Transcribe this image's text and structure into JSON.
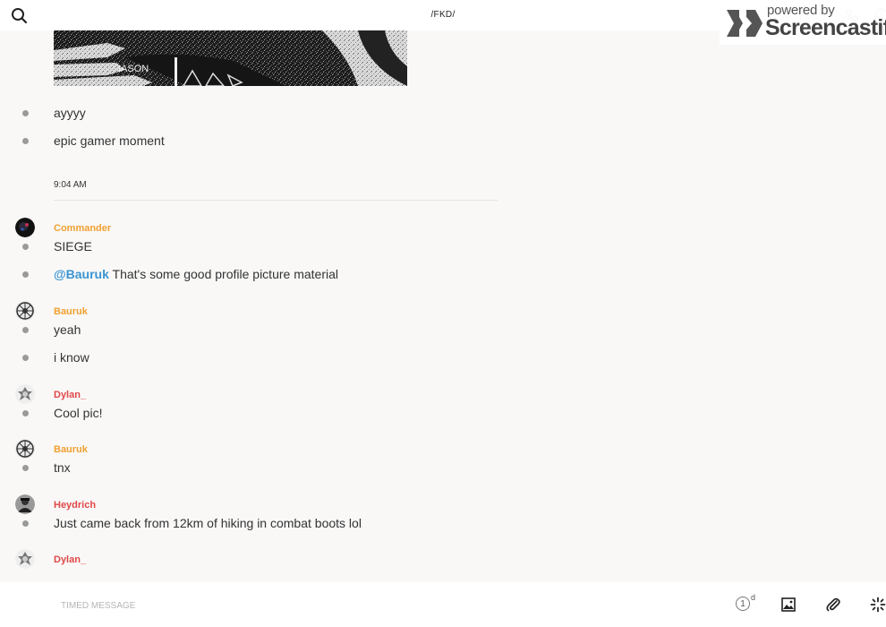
{
  "header": {
    "title": "/FKD/",
    "search_icon": "search-icon",
    "call_icon": "phone-icon",
    "info_icon": "info-icon"
  },
  "watermark": {
    "powered": "powered by",
    "brand": "Screencastify"
  },
  "image_preview": {
    "caption_fragment": "IASON"
  },
  "messages_top": [
    {
      "text": "ayyyy"
    },
    {
      "text": "epic gamer moment"
    }
  ],
  "time_separator": "9:04 AM",
  "groups": [
    {
      "author": "Commander",
      "author_color": "#f0a030",
      "messages": [
        "SIEGE"
      ],
      "mention": "@Bauruk",
      "mention_rest": " That's some good profile picture material"
    },
    {
      "author": "Bauruk",
      "author_color": "#f0a030",
      "messages": [
        "yeah",
        "i know"
      ]
    },
    {
      "author": "Dylan_",
      "author_color": "#e04848",
      "messages": [
        "Cool pic!"
      ]
    },
    {
      "author": "Bauruk",
      "author_color": "#f0a030",
      "messages": [
        "tnx"
      ]
    },
    {
      "author": "Heydrich",
      "author_color": "#e04848",
      "messages": [
        "Just came back from 12km of hiking in combat boots lol"
      ]
    },
    {
      "author": "Dylan_",
      "author_color": "#e04848",
      "messages": []
    }
  ],
  "composer": {
    "placeholder": "TIMED MESSAGE",
    "timer_value": "1",
    "timer_unit": "d",
    "image_icon": "image-icon",
    "attach_icon": "paperclip-icon",
    "sparkle_icon": "sparkle-icon"
  },
  "colors": {
    "accent_orange": "#f0a030",
    "accent_red": "#e04848",
    "mention_blue": "#3a95d0",
    "background": "#f9f8f7"
  }
}
